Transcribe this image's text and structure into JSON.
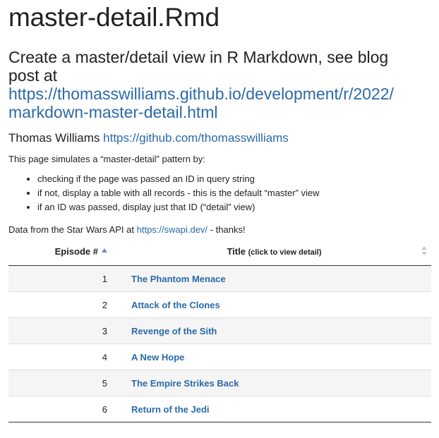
{
  "page": {
    "title": "master-detail.Rmd",
    "subtitle_line1": "Create a master/detail view in R Markdown, see blog",
    "subtitle_line2": "post at",
    "subtitle_link_line1": "https://thomasswilliams.github.io/development/r/2022/",
    "subtitle_link_line2": "markdown-master-detail.html",
    "author_name": "Thomas Williams",
    "author_link": "https://github.com/thomasswilliams",
    "intro": "This page simulates a “master-detail” pattern by:",
    "bullets": [
      "checking if the page was passed an ID in query string",
      "if not, display a table with all records - this is the default “master” view",
      "if an ID was passed, display just that ID (“detail” view)"
    ],
    "data_from_prefix": "Data from the Star Wars API at",
    "data_from_link": "https://swapi.dev/",
    "data_from_suffix": "- thanks!"
  },
  "table": {
    "header_episode": "Episode #",
    "header_title": "Title",
    "header_title_note": "(click to view detail)",
    "rows": [
      {
        "episode": "1",
        "title": "The Phantom Menace"
      },
      {
        "episode": "2",
        "title": "Attack of the Clones"
      },
      {
        "episode": "3",
        "title": "Revenge of the Sith"
      },
      {
        "episode": "4",
        "title": "A New Hope"
      },
      {
        "episode": "5",
        "title": "The Empire Strikes Back"
      },
      {
        "episode": "6",
        "title": "Return of the Jedi"
      }
    ]
  },
  "icons": {
    "episode_sort": "sort-ascending-icon",
    "title_sort": "sort-both-icon"
  },
  "colors": {
    "link": "#2a6aa8",
    "text": "#222222",
    "stripe": "#f5f5f5"
  }
}
